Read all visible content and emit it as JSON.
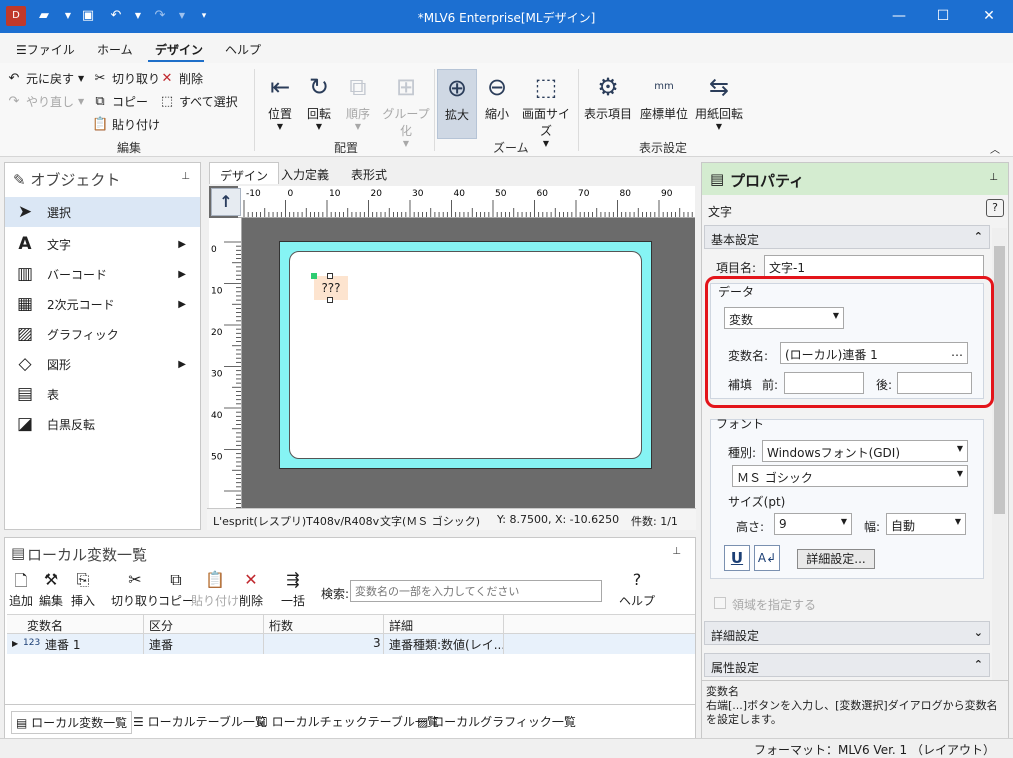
{
  "window": {
    "title": "*MLV6 Enterprise[MLデザイン]"
  },
  "menu": {
    "items": [
      "ファイル",
      "ホーム",
      "デザイン",
      "ヘルプ"
    ]
  },
  "ribbon": {
    "undo": "元に戻す",
    "redo": "やり直し",
    "cut": "切り取り",
    "delete": "削除",
    "copy": "コピー",
    "select_all": "すべて選択",
    "paste": "貼り付け",
    "group_edit": "編集",
    "position": "位置",
    "rotate": "回転",
    "order": "順序",
    "group": "グループ化",
    "group_arrange": "配置",
    "zoom_in": "拡大",
    "zoom_out": "縮小",
    "screen_size": "画面サイズ",
    "group_zoom": "ズーム",
    "display_items": "表示項目",
    "coord_unit": "座標単位",
    "paper_rotate": "用紙回転",
    "unit_mm": "mm",
    "group_display": "表示設定"
  },
  "objects": {
    "title": "オブジェクト",
    "items": [
      "選択",
      "文字",
      "バーコード",
      "2次元コード",
      "グラフィック",
      "図形",
      "表",
      "白黒反転"
    ]
  },
  "design": {
    "tabs": [
      "デザイン",
      "入力定義",
      "表形式"
    ],
    "hruler_labels": [
      "-10",
      "0",
      "10",
      "20",
      "30",
      "40",
      "50",
      "60",
      "70",
      "80",
      "90"
    ],
    "vruler_labels": [
      "0",
      "10",
      "20",
      "30",
      "40",
      "50"
    ],
    "text_object": "???",
    "status": {
      "printer": "L'esprit(レスプリ)T408v/R408v",
      "object": "文字(ＭＳ ゴシック)",
      "coords": "Y: 8.7500, X: -10.6250",
      "count": "件数: 1/1"
    }
  },
  "properties": {
    "title": "プロパティ",
    "object_type": "文字",
    "basic": "基本設定",
    "item_name_label": "項目名:",
    "item_name": "文字-1",
    "data_group": "データ",
    "data_type": "変数",
    "var_name_label": "変数名:",
    "var_name": "(ローカル)連番 1",
    "var_btn": "…",
    "supplement": "補填",
    "before": "前:",
    "after": "後:",
    "before_value": "",
    "after_value": "",
    "font_group": "フォント",
    "kind_label": "種別:",
    "kind": "Windowsフォント(GDI)",
    "font_name": "ＭＳ ゴシック",
    "size_label": "サイズ(pt)",
    "height_label": "高さ:",
    "height": "9",
    "width_label": "幅:",
    "width": "自動",
    "detail_btn": "詳細設定...",
    "area_check": "領域を指定する",
    "detail_section": "詳細設定",
    "attr_section": "属性設定",
    "help_title": "変数名",
    "help_text": "右端[...]ボタンを入力し、[変数選択]ダイアログから変数名を設定します。"
  },
  "local_vars": {
    "title": "ローカル変数一覧",
    "tools": [
      "追加",
      "編集",
      "挿入",
      "切り取り",
      "コピー",
      "貼り付け",
      "削除",
      "一括",
      "ヘルプ"
    ],
    "search_label": "検索:",
    "search_placeholder": "変数名の一部を入力してください",
    "columns": [
      "変数名",
      "区分",
      "桁数",
      "詳細"
    ],
    "rows": [
      {
        "name": "連番 1",
        "kind": "連番",
        "digits": "3",
        "detail": "連番種類:数値(レイ..."
      }
    ],
    "bottom_tabs": [
      "ローカル変数一覧",
      "ローカルテーブル一覧",
      "ローカルチェックテーブル一覧",
      "ローカルグラフィック一覧"
    ]
  },
  "statusbar": {
    "format": "フォーマット：MLV6 Ver. 1 （レイアウト）"
  }
}
